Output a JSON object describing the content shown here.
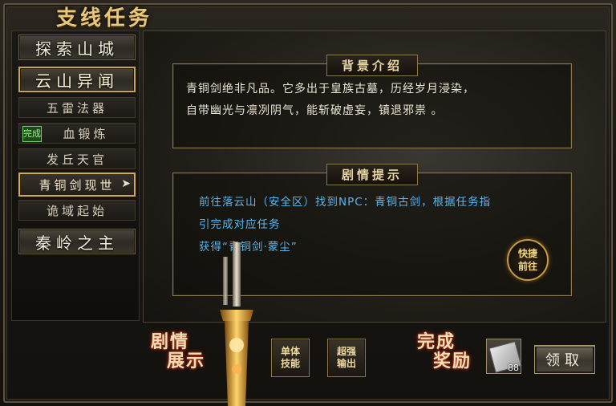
{
  "window": {
    "title": "支线任务"
  },
  "sidebar": {
    "main_items": [
      {
        "label": "探索山城"
      },
      {
        "label": "云山异闻"
      },
      {
        "label": "秦岭之主"
      }
    ],
    "sub_items": [
      {
        "label": "五雷法器"
      },
      {
        "label": "血锻炼",
        "badge": "完成"
      },
      {
        "label": "发丘天官"
      },
      {
        "label": "青铜剑现世"
      },
      {
        "label": "诡域起始"
      }
    ]
  },
  "background_box": {
    "title": "背景介绍",
    "line1": "青铜剑绝非凡品。它多出于皇族古墓，历经岁月浸染，",
    "line2": "自带幽光与凛冽阴气，能斩破虚妄，镇退邪祟 。"
  },
  "plot_box": {
    "title": "剧情提示",
    "line1": "前往落云山（安全区）找到NPC：青铜古剑，根据任务指",
    "line2": "引完成对应任务",
    "line3": "获得“青铜剑·蒙尘”",
    "quick_go_line1": "快捷",
    "quick_go_line2": "前往"
  },
  "bottom": {
    "plot_show_line1": "剧情",
    "plot_show_line2": "展示",
    "skill1_line1": "单体",
    "skill1_line2": "技能",
    "skill2_line1": "超强",
    "skill2_line2": "输出",
    "reward_line1": "完成",
    "reward_line2": "奖励",
    "item_count": "88",
    "claim_label": "领取"
  }
}
